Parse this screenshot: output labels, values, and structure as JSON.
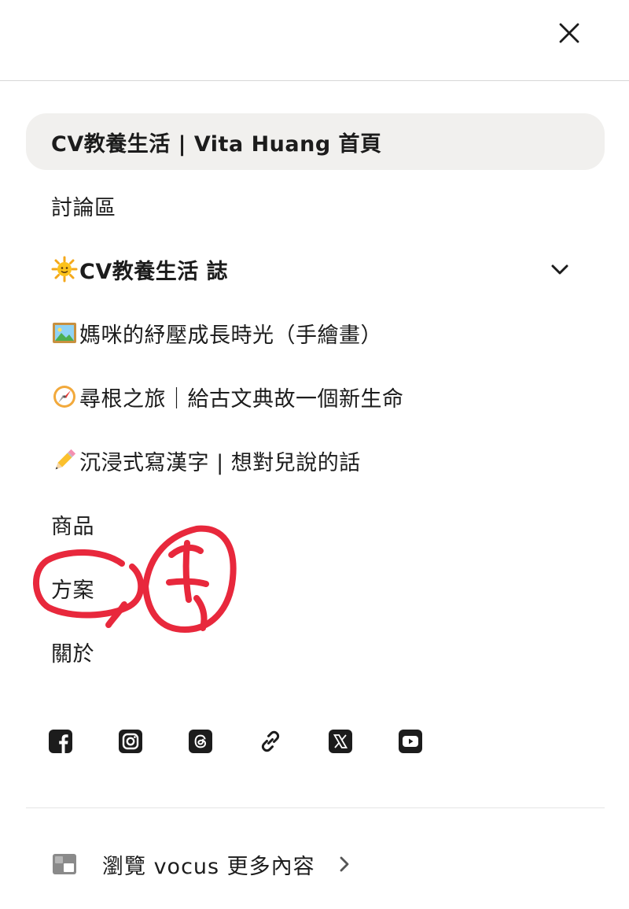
{
  "header": {
    "close_icon": "close-icon"
  },
  "menu": {
    "items": [
      {
        "label": "CV教養生活 | Vita Huang 首頁",
        "emoji": "",
        "active": true
      },
      {
        "label": "討論區",
        "emoji": ""
      },
      {
        "label": "CV教養生活 誌",
        "emoji": "sun-with-face-emoji",
        "expandable": true,
        "chevron_icon": "chevron-down-icon"
      },
      {
        "label": "媽咪的紓壓成長時光（手繪畫）",
        "emoji": "framed-picture-emoji"
      },
      {
        "label": "尋根之旅｜給古文典故一個新生命",
        "emoji": "compass-emoji"
      },
      {
        "label": "沉浸式寫漢字 | 想對兒說的話",
        "emoji": "pencil-emoji"
      },
      {
        "label": "商品",
        "emoji": ""
      },
      {
        "label": "方案",
        "emoji": ""
      },
      {
        "label": "關於",
        "emoji": ""
      }
    ]
  },
  "social": {
    "icons": [
      "facebook-icon",
      "instagram-icon",
      "threads-icon",
      "link-icon",
      "x-icon",
      "youtube-icon"
    ]
  },
  "footer": {
    "browse_label": "瀏覽 vocus 更多內容",
    "logo_icon": "vocus-logo-icon",
    "arrow_icon": "chevron-right-icon"
  },
  "colors": {
    "active_bg": "#f1f0ee",
    "text": "#1c1c1c",
    "scribble": "#e8283c"
  }
}
